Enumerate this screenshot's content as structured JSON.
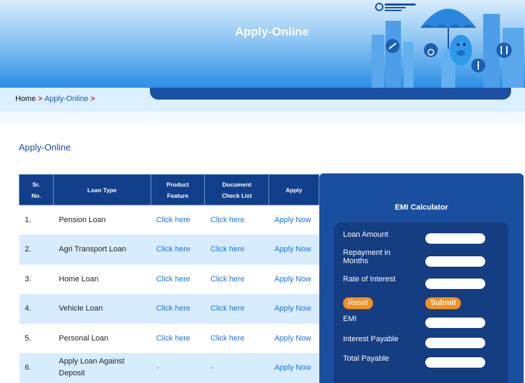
{
  "banner": {
    "title": "Apply-Online"
  },
  "breadcrumb": {
    "home": "Home",
    "separator": ">",
    "current": "Apply-Online",
    "trailing": ">"
  },
  "page": {
    "section_title": "Apply-Online"
  },
  "table": {
    "headers": {
      "sr": "Sr.\nNo.",
      "loan_type": "Loan Type",
      "feature": "Product\nFeature",
      "checklist": "Document\nCheck List",
      "apply": "Apply"
    },
    "rows": [
      {
        "sr": "1.",
        "loan_type": "Pension Loan",
        "feature": "Click here",
        "checklist": "Click here",
        "apply": "Apply Now"
      },
      {
        "sr": "2.",
        "loan_type": "Agri Transport Loan",
        "feature": "Click here",
        "checklist": "Click here",
        "apply": "Apply Now"
      },
      {
        "sr": "3.",
        "loan_type": "Home Loan",
        "feature": "Click here",
        "checklist": "Click here",
        "apply": "Apply Now"
      },
      {
        "sr": "4.",
        "loan_type": "Vehicle Loan",
        "feature": "Click here",
        "checklist": "Click here",
        "apply": "Apply Now"
      },
      {
        "sr": "5.",
        "loan_type": "Personal Loan",
        "feature": "Click here",
        "checklist": "Click here",
        "apply": "Apply Now"
      },
      {
        "sr": "6.",
        "loan_type": "Apply Loan Against Deposit",
        "feature": "-",
        "checklist": "-",
        "apply": "Apply Now"
      }
    ]
  },
  "emi": {
    "title": "EMI Calculator",
    "loan_amount": "Loan Amount",
    "repayment": "Repayment in Months",
    "rate": "Rate of Interest",
    "reset": "Reset",
    "submit": "Submit",
    "emi": "EMI",
    "interest_payable": "Interest Payable",
    "total_payable": "Total Payable"
  },
  "colors": {
    "navy": "#123f8c",
    "accent_orange": "#f7901e",
    "link_blue": "#1a73e8",
    "row_alt": "#d8ecff"
  },
  "icons": [
    "bank-logo-icon",
    "umbrella-icon",
    "piggy-bank-icon",
    "skier-icon",
    "wheelchair-icon",
    "family-icon",
    "elderly-icon"
  ]
}
